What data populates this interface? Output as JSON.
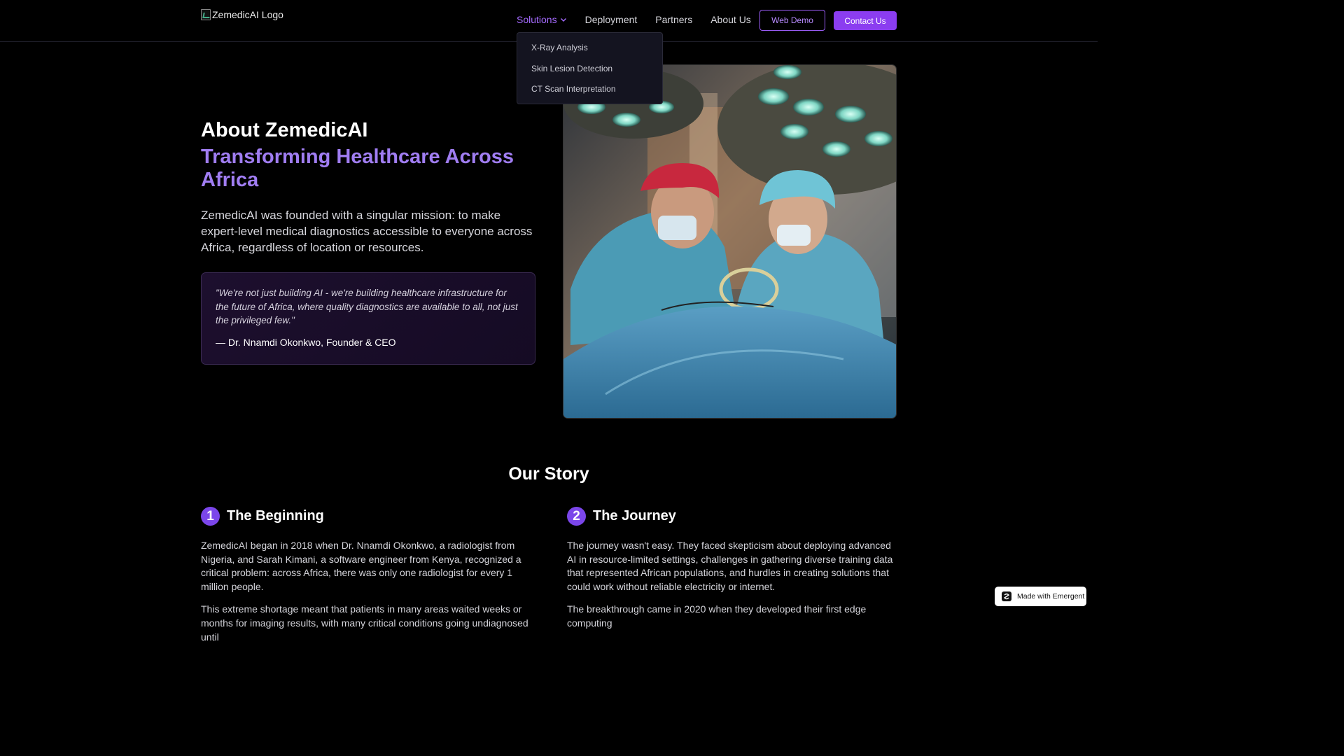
{
  "nav": {
    "logo_alt": "ZemedicAI Logo",
    "links": [
      "Solutions",
      "Deployment",
      "Partners",
      "About Us"
    ],
    "web_demo": "Web Demo",
    "contact": "Contact Us",
    "dropdown": [
      "X-Ray Analysis",
      "Skin Lesion Detection",
      "CT Scan Interpretation"
    ],
    "accent_color": "#a56bff"
  },
  "hero": {
    "title": "About ZemedicAI",
    "subtitle": "Transforming Healthcare Across Africa",
    "paragraph": "ZemedicAI was founded with a singular mission: to make expert-level medical diagnostics accessible to everyone across Africa, regardless of location or resources.",
    "quote": "\"We're not just building AI - we're building healthcare infrastructure for the future of Africa, where quality diagnostics are available to all, not just the privileged few.\"",
    "quote_author": "— Dr. Nnamdi Okonkwo, Founder & CEO",
    "image_icon": "surgery-photo"
  },
  "story": {
    "title": "Our Story",
    "items": [
      {
        "num": "1",
        "title": "The Beginning",
        "paragraphs": [
          "ZemedicAI began in 2018 when Dr. Nnamdi Okonkwo, a radiologist from Nigeria, and Sarah Kimani, a software engineer from Kenya, recognized a critical problem: across Africa, there was only one radiologist for every 1 million people.",
          "This extreme shortage meant that patients in many areas waited weeks or months for imaging results, with many critical conditions going undiagnosed until"
        ]
      },
      {
        "num": "2",
        "title": "The Journey",
        "paragraphs": [
          "The journey wasn't easy. They faced skepticism about deploying advanced AI in resource-limited settings, challenges in gathering diverse training data that represented African populations, and hurdles in creating solutions that could work without reliable electricity or internet.",
          "The breakthrough came in 2020 when they developed their first edge computing"
        ]
      }
    ]
  },
  "badge": {
    "label": "Made with Emergent"
  }
}
